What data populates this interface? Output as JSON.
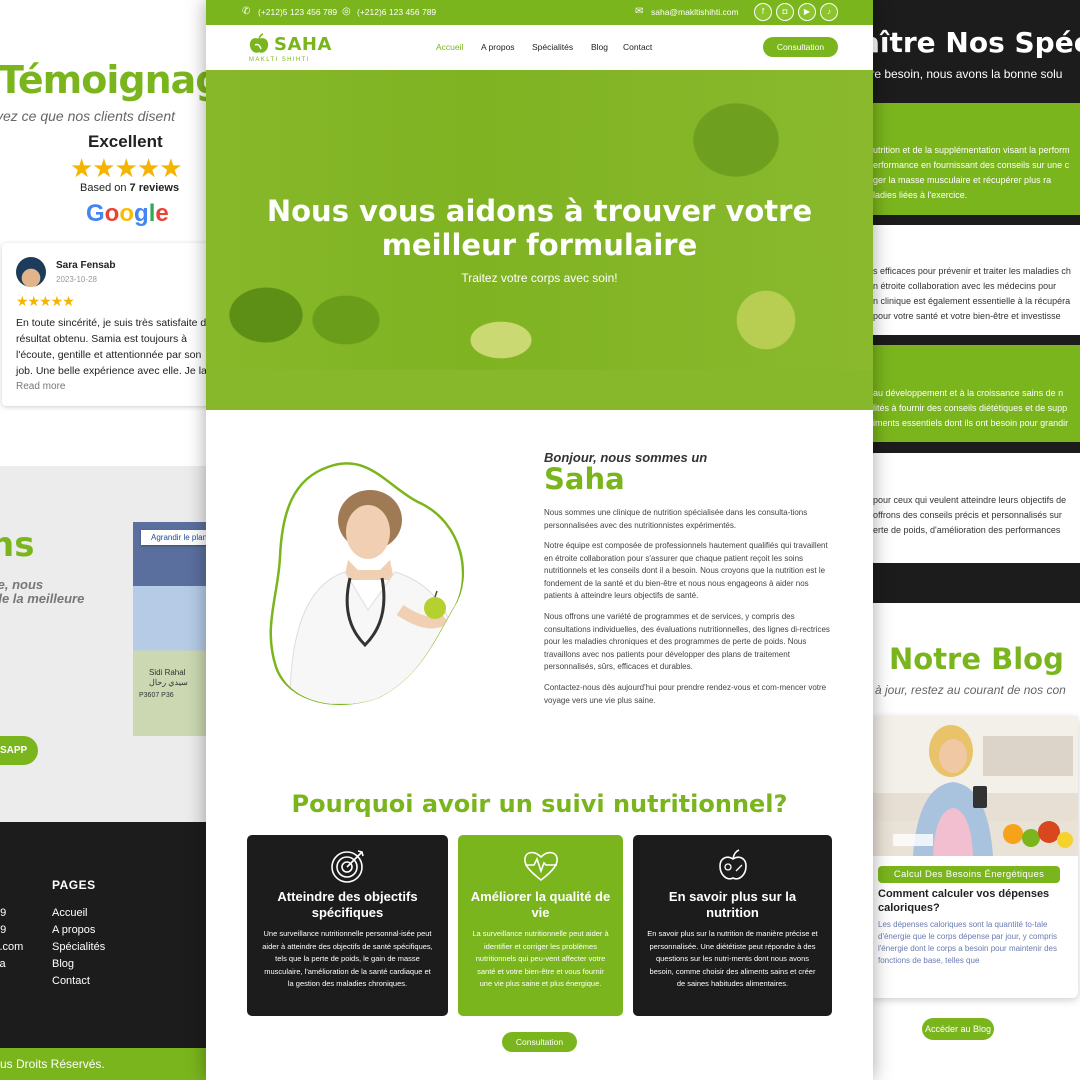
{
  "left": {
    "testimonials_title": "Témoignag",
    "testimonials_subtitle": "yez ce que nos clients disent",
    "rating_label": "Excellent",
    "rating_stars": "★★★★★",
    "based_on_prefix": "Based on ",
    "reviews_count": "7 reviews",
    "google_letters": [
      "G",
      "o",
      "o",
      "g",
      "l",
      "e"
    ],
    "review": {
      "name": "Sara Fensab",
      "date": "2023-10-28",
      "stars": "★★★★★",
      "text": "En toute sincérité, je suis très satisfaite du résultat obtenu. Samia est toujours à l'écoute, gentille et attentionnée par son job. Une belle expérience avec elle. Je la",
      "read_more": "Read more"
    },
    "contact_title": "ns",
    "contact_subtitle": "le, nous\nde la meilleure",
    "map": {
      "enlarge_label": "Agrandir le plan",
      "place_latin": "Sidi Rahal",
      "place_arabic": "سيدي رحال",
      "codes": "P3607   P36"
    },
    "whatsapp_label": "SAPP",
    "footer": {
      "pages_title": "PAGES",
      "links": [
        "Accueil",
        "A propos",
        "Spécialités",
        "Blog",
        "Contact"
      ],
      "contact_fragments": [
        "89",
        "89",
        "ti.com",
        "ca"
      ]
    },
    "copyright": "us Droits Réservés."
  },
  "right": {
    "specialties_title": "aître Nos Spécia",
    "specialties_subtitle": "tre besoin, nous avons la bonne solu",
    "blocks": [
      {
        "theme": "green",
        "lines": "utrition et de la supplémentation visant la perform\nerformance en fournissant des conseils sur une c\nger la masse musculaire et récupérer plus ra\nladies liées à l'exercice."
      },
      {
        "theme": "white",
        "lines": "s efficaces pour prévenir et traiter les maladies ch\nn étroite collaboration avec les médecins pour\nn clinique est également essentielle à la récupéra\npour votre santé et votre bien-être et investisse"
      },
      {
        "theme": "green",
        "lines": "au développement et à la croissance sains de n\nlités à fournir des conseils diététiques et de supp\niments essentiels dont ils ont besoin pour grandir"
      },
      {
        "theme": "white",
        "lines": "pour ceux qui veulent atteindre leurs objectifs de\noffrons des conseils précis et personnalisés sur\nerte de poids, d'amélioration des performances"
      }
    ],
    "blog_title": "Notre Blog",
    "blog_subtitle": "à jour, restez au courant de nos con",
    "card": {
      "tag": "Calcul Des Besoins Énergétiques",
      "title": "Comment calculer vos dépenses caloriques?",
      "excerpt": "Les dépenses caloriques sont la quantité to-tale d'énergie que le corps dépense par jour, y compris l'énergie dont le corps a besoin pour maintenir des fonctions de base, telles que"
    },
    "blog_button": "Accéder au Blog"
  },
  "main": {
    "topbar": {
      "phone1": "(+212)5 123 456 789",
      "phone2": "(+212)6 123 456 789",
      "email": "saha@makltishihti.com",
      "socials": [
        "facebook-icon",
        "instagram-icon",
        "youtube-icon",
        "tiktok-icon"
      ]
    },
    "logo": {
      "name": "SAHA",
      "tagline": "MAKLTI SHIHTI"
    },
    "nav": [
      "Accueil",
      "A propos",
      "Spécialités",
      "Blog",
      "Contact"
    ],
    "nav_active": 0,
    "cta": "Consultation",
    "hero": {
      "title": "Nous vous aidons à trouver votre meilleur formulaire",
      "subtitle": "Traitez votre corps avec soin!"
    },
    "intro": {
      "greeting": "Bonjour, nous sommes un",
      "name": "Saha",
      "paragraphs": [
        "Nous sommes une clinique de nutrition spécialisée dans les consulta-tions personnalisées avec des nutritionnistes expérimentés.",
        "Notre équipe est composée de professionnels hautement qualifiés qui travaillent en étroite collaboration pour s'assurer que chaque patient reçoit les soins nutritionnels et les conseils dont il a besoin. Nous croyons que la nutrition est le fondement de la santé et du bien-être et nous nous engageons à aider nos patients à atteindre leurs objectifs de santé.",
        "Nous offrons une variété de programmes et de services, y compris des consultations individuelles, des évaluations nutritionnelles, des lignes di-rectrices pour les maladies chroniques et des programmes de perte de poids. Nous travaillons avec nos patients pour développer des plans de traitement personnalisés, sûrs, efficaces et durables.",
        "Contactez-nous dès aujourd'hui pour prendre rendez-vous et com-mencer votre voyage vers une vie plus saine."
      ]
    },
    "why": {
      "title": "Pourquoi avoir un suivi nutritionnel?",
      "features": [
        {
          "icon": "target-icon",
          "theme": "dark",
          "title": "Atteindre des objectifs spécifiques",
          "text": "Une surveillance nutritionnelle personnal-isée peut aider à atteindre des objectifs de santé spécifiques, tels que la perte de poids, le gain de masse musculaire, l'amélioration de la santé cardiaque et la gestion des maladies chroniques."
        },
        {
          "icon": "heartbeat-icon",
          "theme": "green",
          "title": "Améliorer la qualité de vie",
          "text": "La surveillance nutritionnelle peut aider à identifier et corriger les problèmes nutritionnels qui peu-vent affecter votre santé et votre bien-être et vous fournir une vie plus saine et plus énergique."
        },
        {
          "icon": "nutrition-icon",
          "theme": "dark",
          "title": "En savoir plus sur la nutrition",
          "text": "En savoir plus sur la nutrition de manière précise et personnalisée. Une diététiste peut répondre à des questions sur les nutri-ments dont nous avons besoin, comme choisir des aliments sains et créer de saines habitudes alimentaires."
        }
      ],
      "button": "Consultation"
    },
    "colors": {
      "accent": "#7ab51d",
      "dark": "#1c1c1c"
    }
  }
}
